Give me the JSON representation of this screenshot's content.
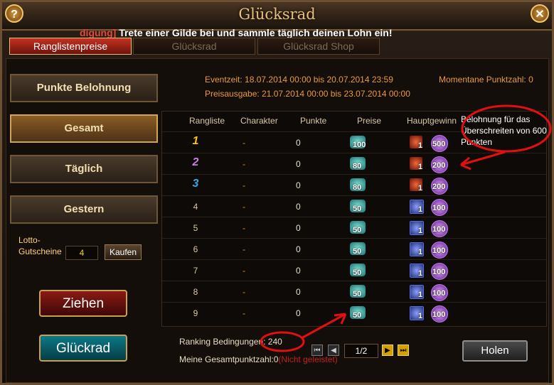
{
  "window": {
    "title": "Glücksrad",
    "help_label": "?",
    "close_label": "✕"
  },
  "announcement": {
    "prefix": "digung]",
    "text": "Trete einer Gilde bei und sammle täglich deinen Lohn ein!"
  },
  "tabs": [
    {
      "label": "Ranglistenpreise",
      "active": true
    },
    {
      "label": "Glücksrad",
      "active": false
    },
    {
      "label": "Glücksrad Shop",
      "active": false
    }
  ],
  "left_menu": [
    {
      "label": "Punkte Belohnung"
    },
    {
      "label": "Gesamt",
      "selected": true
    },
    {
      "label": "Täglich"
    },
    {
      "label": "Gestern"
    }
  ],
  "lotto": {
    "label_line1": "Lotto-",
    "label_line2": "Gutscheine",
    "value": "4",
    "buy_label": "Kaufen"
  },
  "actions": {
    "draw_label": "Ziehen",
    "wheel_label": "Glückrad"
  },
  "event": {
    "time": "Eventzeit: 18.07.2014 00:00 bis 20.07.2014 23:59",
    "payout": "Preisausgabe: 21.07.2014 00:00 bis 23.07.2014 00:00",
    "current_points": "Momentane Punktzahl:  0"
  },
  "table": {
    "headers": [
      "Rangliste",
      "Charakter",
      "Punkte",
      "Preise",
      "Hauptgewinn"
    ],
    "rows": [
      {
        "rank": "1",
        "character": "-",
        "points": "0",
        "gem": "100",
        "item_type": "red",
        "item": "1",
        "orb": "500"
      },
      {
        "rank": "2",
        "character": "-",
        "points": "0",
        "gem": "80",
        "item_type": "red",
        "item": "1",
        "orb": "200"
      },
      {
        "rank": "3",
        "character": "-",
        "points": "0",
        "gem": "80",
        "item_type": "red",
        "item": "1",
        "orb": "200"
      },
      {
        "rank": "4",
        "character": "-",
        "points": "0",
        "gem": "50",
        "item_type": "blue",
        "item": "1",
        "orb": "100"
      },
      {
        "rank": "5",
        "character": "-",
        "points": "0",
        "gem": "50",
        "item_type": "blue",
        "item": "1",
        "orb": "100"
      },
      {
        "rank": "6",
        "character": "-",
        "points": "0",
        "gem": "50",
        "item_type": "blue",
        "item": "1",
        "orb": "100"
      },
      {
        "rank": "7",
        "character": "-",
        "points": "0",
        "gem": "50",
        "item_type": "blue",
        "item": "1",
        "orb": "100"
      },
      {
        "rank": "8",
        "character": "-",
        "points": "0",
        "gem": "50",
        "item_type": "blue",
        "item": "1",
        "orb": "100"
      },
      {
        "rank": "9",
        "character": "-",
        "points": "0",
        "gem": "50",
        "item_type": "blue",
        "item": "1",
        "orb": "100"
      }
    ]
  },
  "footer": {
    "ranking_condition": "Ranking Bedingungen: 240",
    "total_points": "Meine Gesamtpunktzahl:0",
    "total_status": "(Nicht geleistet)",
    "page": "1/2",
    "collect_label": "Holen"
  },
  "annotation": {
    "text": "Belohnung für das Überschreiten von 600 Punkten"
  },
  "colors": {
    "accent_gold": "#e8c07a",
    "annotation_red": "#e01010",
    "info_orange": "#e89a3a"
  }
}
